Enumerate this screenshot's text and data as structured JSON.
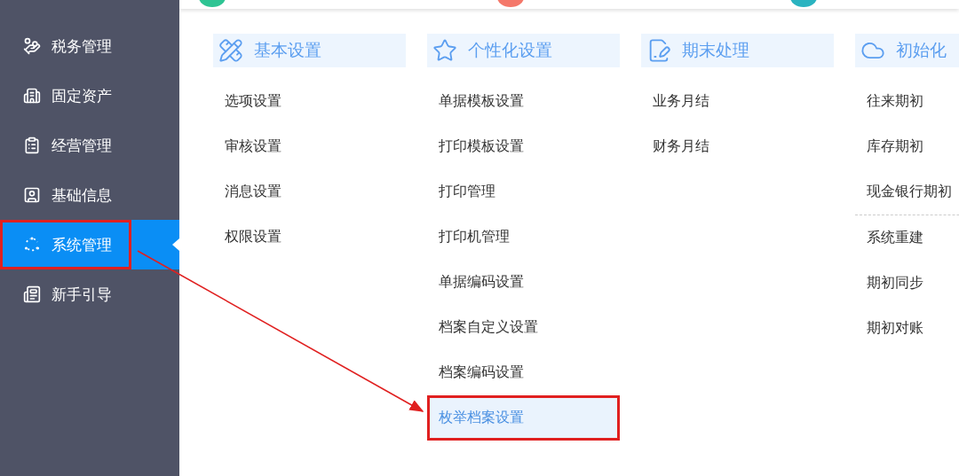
{
  "sidebar": {
    "items": [
      {
        "label": "税务管理",
        "selected": false,
        "annotated": false
      },
      {
        "label": "固定资产",
        "selected": false,
        "annotated": false
      },
      {
        "label": "经营管理",
        "selected": false,
        "annotated": false
      },
      {
        "label": "基础信息",
        "selected": false,
        "annotated": false
      },
      {
        "label": "系统管理",
        "selected": true,
        "annotated": true
      },
      {
        "label": "新手引导",
        "selected": false,
        "annotated": false
      }
    ]
  },
  "columns": [
    {
      "title": "基本设置",
      "groups": [
        [
          {
            "label": "选项设置",
            "selected": false,
            "annotated": false
          },
          {
            "label": "审核设置",
            "selected": false,
            "annotated": false
          },
          {
            "label": "消息设置",
            "selected": false,
            "annotated": false
          },
          {
            "label": "权限设置",
            "selected": false,
            "annotated": false
          }
        ]
      ]
    },
    {
      "title": "个性化设置",
      "groups": [
        [
          {
            "label": "单据模板设置",
            "selected": false,
            "annotated": false
          },
          {
            "label": "打印模板设置",
            "selected": false,
            "annotated": false
          },
          {
            "label": "打印管理",
            "selected": false,
            "annotated": false
          },
          {
            "label": "打印机管理",
            "selected": false,
            "annotated": false
          },
          {
            "label": "单据编码设置",
            "selected": false,
            "annotated": false
          },
          {
            "label": "档案自定义设置",
            "selected": false,
            "annotated": false
          },
          {
            "label": "档案编码设置",
            "selected": false,
            "annotated": false
          },
          {
            "label": "枚举档案设置",
            "selected": true,
            "annotated": true
          }
        ]
      ]
    },
    {
      "title": "期末处理",
      "groups": [
        [
          {
            "label": "业务月结",
            "selected": false,
            "annotated": false
          },
          {
            "label": "财务月结",
            "selected": false,
            "annotated": false
          }
        ]
      ]
    },
    {
      "title": "初始化",
      "groups": [
        [
          {
            "label": "往来期初",
            "selected": false,
            "annotated": false
          },
          {
            "label": "库存期初",
            "selected": false,
            "annotated": false
          },
          {
            "label": "现金银行期初",
            "selected": false,
            "annotated": false
          }
        ],
        [
          {
            "label": "系统重建",
            "selected": false,
            "annotated": false
          },
          {
            "label": "期初同步",
            "selected": false,
            "annotated": false
          },
          {
            "label": "期初对账",
            "selected": false,
            "annotated": false
          }
        ]
      ]
    }
  ]
}
